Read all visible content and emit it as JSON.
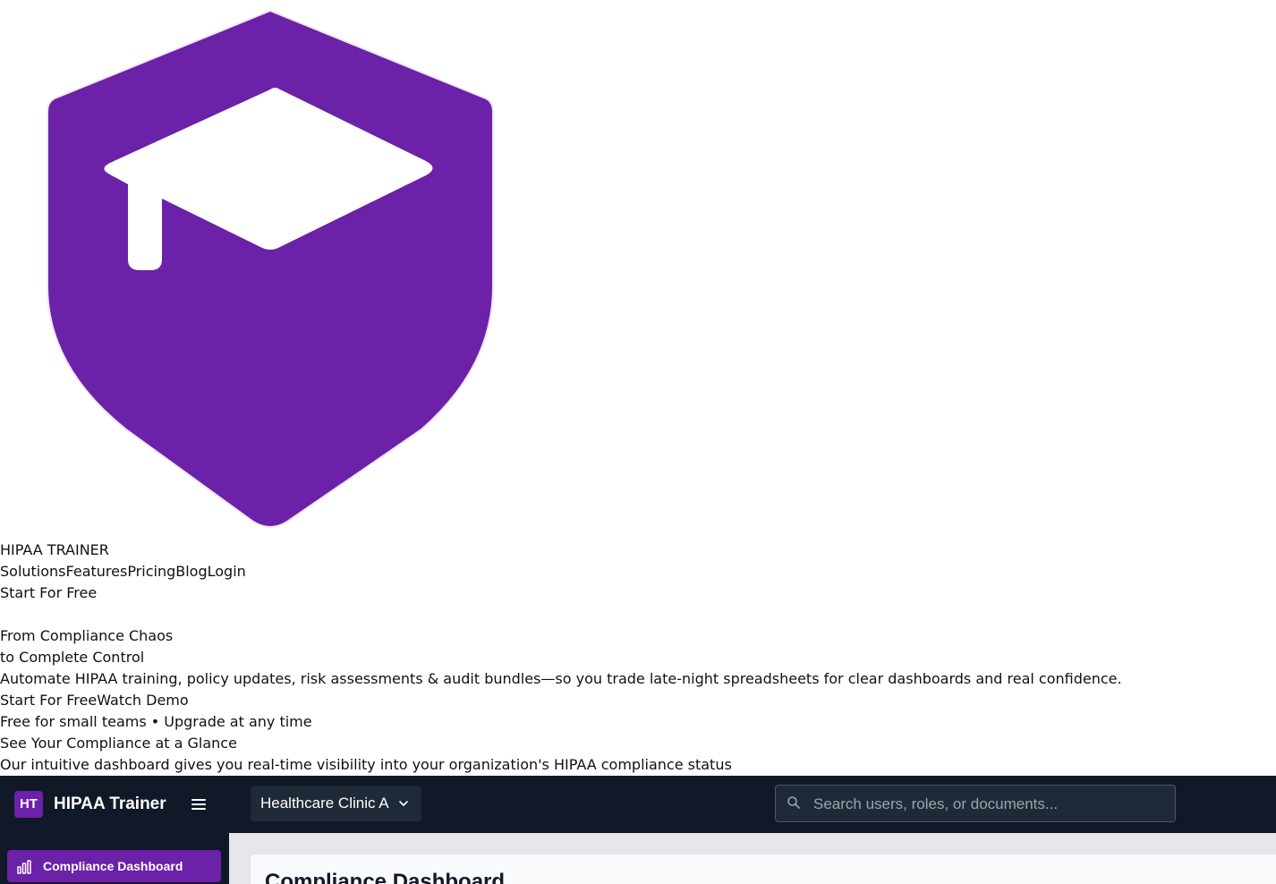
{
  "brand": {
    "name": "HIPAA TRAINER",
    "logo_icon": "shield-graduation-cap-icon",
    "logo_color": "#6b21a8"
  },
  "nav": {
    "items": [
      {
        "label": "Solutions"
      },
      {
        "label": "Features"
      },
      {
        "label": "Pricing"
      },
      {
        "label": "Blog"
      },
      {
        "label": "Login"
      }
    ],
    "cta_label": "Start For Free"
  },
  "hero": {
    "headline_line1": "From Compliance Chaos",
    "headline_line2": "to Complete Control",
    "description": "Automate HIPAA training, policy updates, risk assessments & audit bundles—so you trade late-night spreadsheets for clear dashboards and real confidence.",
    "primary_cta": "Start For Free",
    "secondary_cta": "Watch Demo",
    "note": "Free for small teams • Upgrade at any time"
  },
  "preview_section": {
    "title": "See Your Compliance at a Glance",
    "subtitle": "Our intuitive dashboard gives you real-time visibility into your organization's HIPAA compliance status"
  },
  "dashboard": {
    "colors": {
      "topbar": "#111827",
      "accent": "#6b21a8",
      "input_bg": "#1f2937"
    },
    "brand_badge": "HT",
    "brand_name": "HIPAA Trainer",
    "menu_icon": "hamburger-menu-icon",
    "org_selector": {
      "value": "Healthcare Clinic A",
      "icon": "chevron-down-icon"
    },
    "search": {
      "placeholder": "Search users, roles, or documents...",
      "value": "",
      "icon": "search-icon"
    },
    "sidebar": {
      "active_item": {
        "label": "Compliance Dashboard",
        "icon": "bar-chart-icon"
      }
    },
    "main": {
      "title": "Compliance Dashboard"
    }
  }
}
